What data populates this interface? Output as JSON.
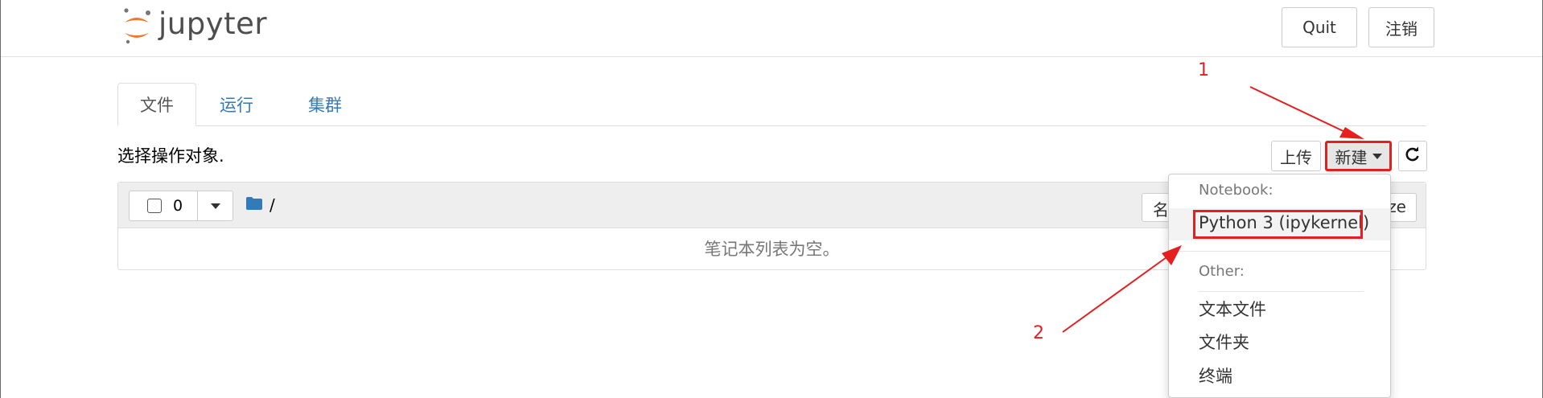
{
  "header": {
    "logo_text": "jupyter",
    "quit_label": "Quit",
    "logout_label": "注销"
  },
  "tabs": [
    {
      "label": "文件",
      "active": true
    },
    {
      "label": "运行",
      "active": false
    },
    {
      "label": "集群",
      "active": false
    }
  ],
  "toolbar": {
    "select_label": "选择操作对象.",
    "upload_label": "上传",
    "new_label": "新建"
  },
  "listing": {
    "selected_count": "0",
    "path": "/",
    "name_col_start": "名",
    "name_col_end": "ze",
    "empty_message": "笔记本列表为空。"
  },
  "new_menu": {
    "notebook_header": "Notebook:",
    "notebook_kernel": "Python 3 (ipykernel)",
    "other_header": "Other:",
    "items": [
      "文本文件",
      "文件夹",
      "终端"
    ]
  },
  "annotations": {
    "step1": "1",
    "step2": "2"
  },
  "colors": {
    "link": "#337ab7",
    "annotation": "#e51f1f",
    "jupyter_orange": "#f37726"
  },
  "icons": [
    "jupyter-logo-icon",
    "caret-down-icon",
    "refresh-icon",
    "folder-icon",
    "checkbox-icon"
  ]
}
